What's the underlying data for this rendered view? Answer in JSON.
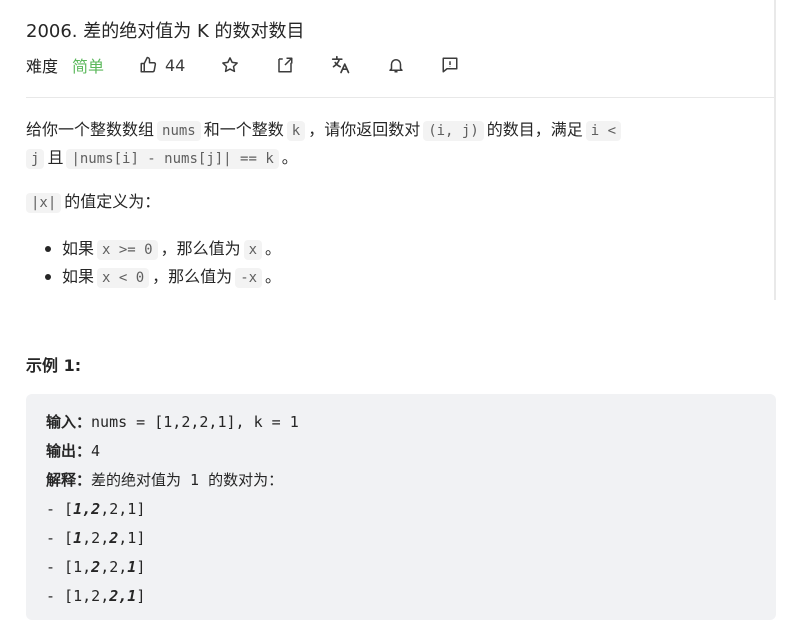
{
  "title": "2006. 差的绝对值为 K 的数对数目",
  "meta": {
    "difficulty_label": "难度",
    "difficulty_value": "简单",
    "likes": "44",
    "icons": [
      "thumbs-up-icon",
      "star-icon",
      "share-icon",
      "translate-icon",
      "bell-icon",
      "feedback-icon"
    ],
    "difficulty_color": "#5cb85c"
  },
  "description": {
    "line1": {
      "t1": "给你一个整数数组",
      "c1": "nums",
      "t2": "和一个整数",
      "c2": "k",
      "t3": "，请你返回数对",
      "c3": "(i, j)",
      "t4": "的数目，满足",
      "c4": "i <"
    },
    "line2": {
      "c1": "j",
      "t1": "且",
      "c2": "|nums[i] - nums[j]| == k",
      "t2": "。"
    },
    "line3": {
      "c1": "|x|",
      "t1": "的值定义为："
    },
    "bullets": [
      {
        "t1": "如果",
        "c1": "x >= 0",
        "t2": "，那么值为",
        "c2": "x",
        "t3": "。"
      },
      {
        "t1": "如果",
        "c1": "x < 0",
        "t2": "，那么值为",
        "c2": "-x",
        "t3": "。"
      }
    ]
  },
  "example": {
    "title": "示例 1:",
    "input_label": "输入：",
    "input_value": "nums = [1,2,2,1], k = 1",
    "output_label": "输出：",
    "output_value": "4",
    "explain_label": "解释：",
    "explain_value": "差的绝对值为 1 的数对为：",
    "pairs": [
      [
        "1",
        "2",
        "2",
        "1"
      ],
      [
        "1",
        "2",
        "2",
        "1"
      ],
      [
        "1",
        "2",
        "2",
        "1"
      ],
      [
        "1",
        "2",
        "2",
        "1"
      ]
    ],
    "pair_highlights": [
      [
        0,
        1
      ],
      [
        0,
        2
      ],
      [
        1,
        3
      ],
      [
        2,
        3
      ]
    ]
  }
}
